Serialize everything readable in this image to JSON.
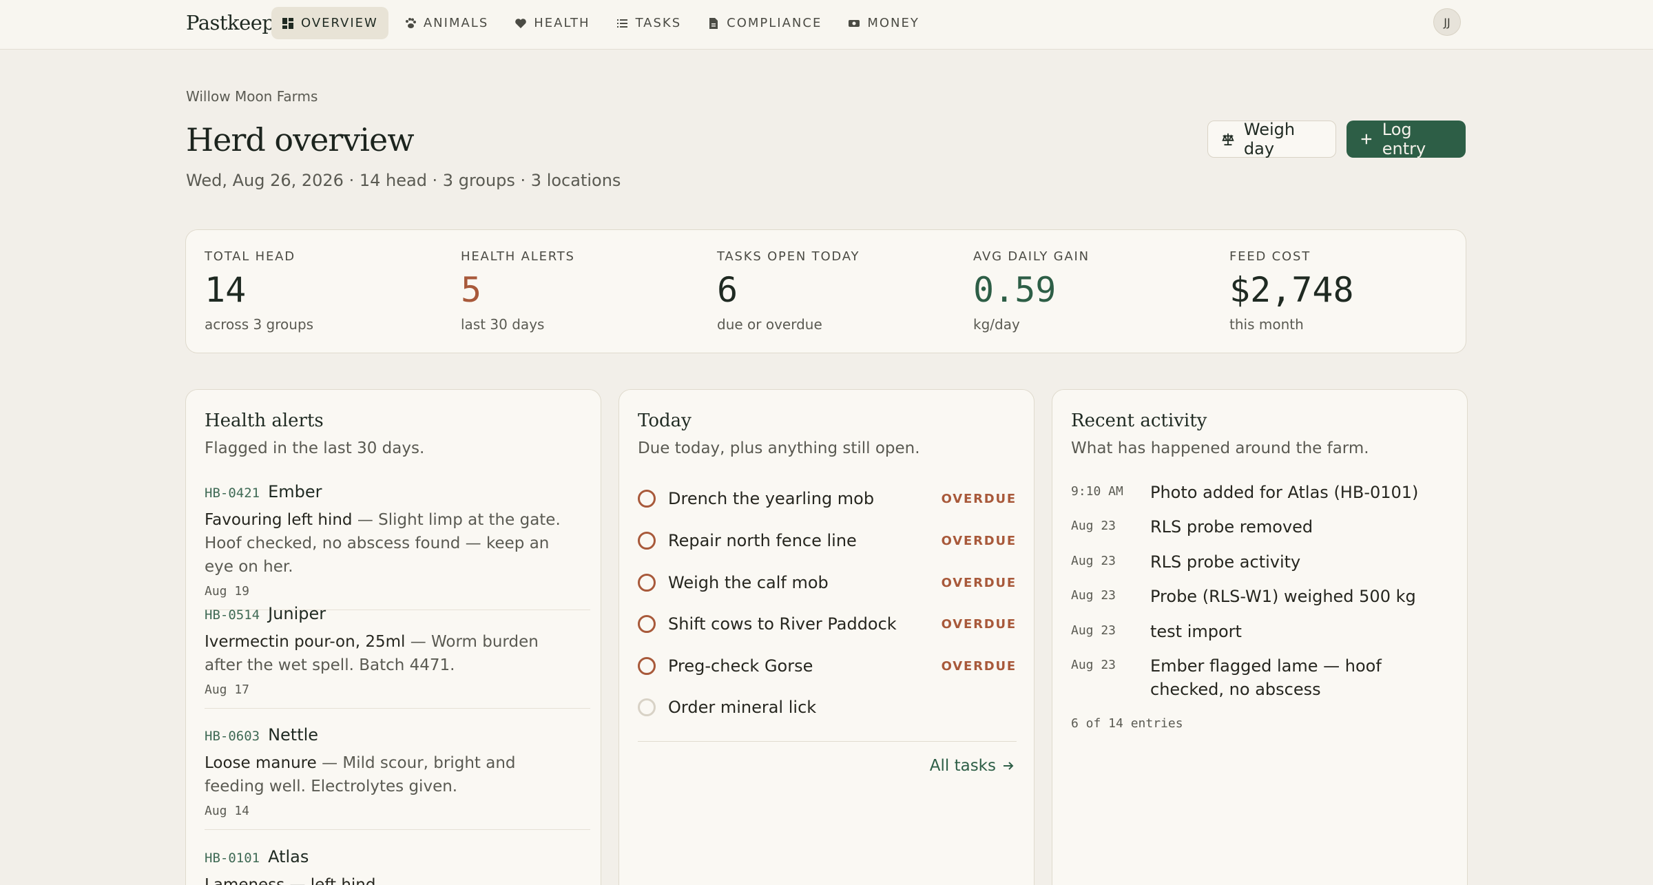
{
  "nav": {
    "brand": "Pastkeep",
    "items": [
      {
        "label": "OVERVIEW",
        "icon": "grid-icon"
      },
      {
        "label": "ANIMALS",
        "icon": "paw-icon"
      },
      {
        "label": "HEALTH",
        "icon": "heart-icon"
      },
      {
        "label": "TASKS",
        "icon": "list-icon"
      },
      {
        "label": "COMPLIANCE",
        "icon": "document-icon"
      },
      {
        "label": "MONEY",
        "icon": "money-icon"
      }
    ],
    "active": "OVERVIEW",
    "avatar": "JJ"
  },
  "header": {
    "farm": "Willow Moon Farms",
    "title": "Herd overview",
    "meta": "Wed, Aug 26, 2026 · 14 head · 3 groups · 3 locations",
    "weigh_label": "Weigh day",
    "log_label": "Log entry"
  },
  "stats": [
    {
      "label": "TOTAL HEAD",
      "value": "14",
      "sub": "across 3 groups",
      "color": "#1f2a22"
    },
    {
      "label": "HEALTH ALERTS",
      "value": "5",
      "sub": "last 30 days",
      "color": "#a8593a"
    },
    {
      "label": "TASKS OPEN TODAY",
      "value": "6",
      "sub": "due or overdue",
      "color": "#1f2a22"
    },
    {
      "label": "AVG DAILY GAIN",
      "value": "0.59",
      "sub": "kg/day",
      "color": "#2d5e46"
    },
    {
      "label": "FEED COST",
      "value": "$2,748",
      "sub": "this month",
      "color": "#1f2a22"
    }
  ],
  "health": {
    "title": "Health alerts",
    "subtitle": "Flagged in the last 30 days.",
    "alerts": [
      {
        "id": "HB-0421",
        "name": "Ember",
        "issue": "Favouring left hind",
        "note": " — Slight limp at the gate. Hoof checked, no abscess found — keep an eye on her.",
        "date": "Aug 19"
      },
      {
        "id": "HB-0514",
        "name": "Juniper",
        "issue": "Ivermectin pour-on, 25ml",
        "note": " — Worm burden after the wet spell. Batch 4471.",
        "date": "Aug 17"
      },
      {
        "id": "HB-0603",
        "name": "Nettle",
        "issue": "Loose manure",
        "note": " — Mild scour, bright and feeding well. Electrolytes given.",
        "date": "Aug 14"
      },
      {
        "id": "HB-0101",
        "name": "Atlas",
        "issue": "Lameness — left hind",
        "note": "",
        "date": ""
      }
    ]
  },
  "today": {
    "title": "Today",
    "subtitle": "Due today, plus anything still open.",
    "tasks": [
      {
        "label": "Drench the yearling mob",
        "status": "OVERDUE"
      },
      {
        "label": "Repair north fence line",
        "status": "OVERDUE"
      },
      {
        "label": "Weigh the calf mob",
        "status": "OVERDUE"
      },
      {
        "label": "Shift cows to River Paddock",
        "status": "OVERDUE"
      },
      {
        "label": "Preg-check Gorse",
        "status": "OVERDUE"
      },
      {
        "label": "Order mineral lick",
        "status": ""
      }
    ],
    "all_tasks": "All tasks"
  },
  "activity": {
    "title": "Recent activity",
    "subtitle": "What has happened around the farm.",
    "items": [
      {
        "time": "9:10 AM",
        "text": "Photo added for Atlas (HB-0101)"
      },
      {
        "time": "Aug 23",
        "text": "RLS probe removed"
      },
      {
        "time": "Aug 23",
        "text": "RLS probe activity"
      },
      {
        "time": "Aug 23",
        "text": "Probe (RLS-W1) weighed 500 kg"
      },
      {
        "time": "Aug 23",
        "text": "test import"
      },
      {
        "time": "Aug 23",
        "text": "Ember flagged lame — hoof checked, no abscess"
      }
    ],
    "count": "6 of 14 entries"
  }
}
